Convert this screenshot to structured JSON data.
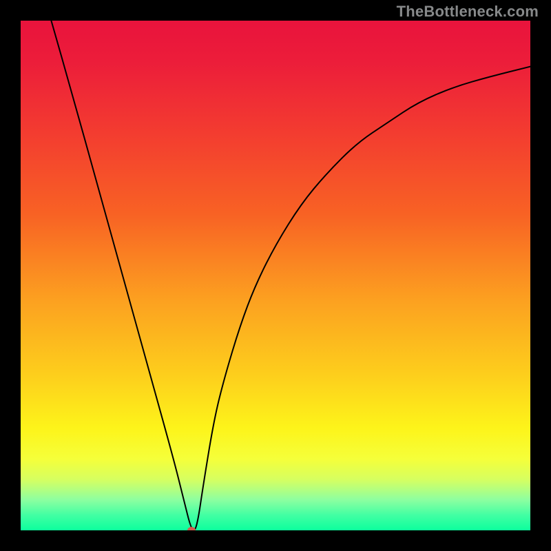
{
  "watermark": "TheBottleneck.com",
  "colors": {
    "curve_stroke": "#000000",
    "marker_fill": "#d25a4f",
    "gradient_top": "#e9133c",
    "gradient_bottom": "#0cff9d"
  },
  "chart_data": {
    "type": "line",
    "title": "",
    "xlabel": "",
    "ylabel": "",
    "x_range": [
      0,
      1
    ],
    "y_range": [
      0,
      1
    ],
    "minimum_x": 0.335,
    "minimum_y": 0.0,
    "curve_points": [
      {
        "x": 0.06,
        "y": 1.0
      },
      {
        "x": 0.1,
        "y": 0.86
      },
      {
        "x": 0.15,
        "y": 0.68
      },
      {
        "x": 0.2,
        "y": 0.5
      },
      {
        "x": 0.25,
        "y": 0.32
      },
      {
        "x": 0.3,
        "y": 0.14
      },
      {
        "x": 0.32,
        "y": 0.06
      },
      {
        "x": 0.335,
        "y": 0.0
      },
      {
        "x": 0.345,
        "y": 0.0
      },
      {
        "x": 0.36,
        "y": 0.1
      },
      {
        "x": 0.38,
        "y": 0.22
      },
      {
        "x": 0.4,
        "y": 0.3
      },
      {
        "x": 0.43,
        "y": 0.4
      },
      {
        "x": 0.46,
        "y": 0.48
      },
      {
        "x": 0.5,
        "y": 0.56
      },
      {
        "x": 0.55,
        "y": 0.64
      },
      {
        "x": 0.6,
        "y": 0.7
      },
      {
        "x": 0.66,
        "y": 0.76
      },
      {
        "x": 0.72,
        "y": 0.8
      },
      {
        "x": 0.78,
        "y": 0.84
      },
      {
        "x": 0.85,
        "y": 0.87
      },
      {
        "x": 0.92,
        "y": 0.89
      },
      {
        "x": 1.0,
        "y": 0.91
      }
    ]
  }
}
